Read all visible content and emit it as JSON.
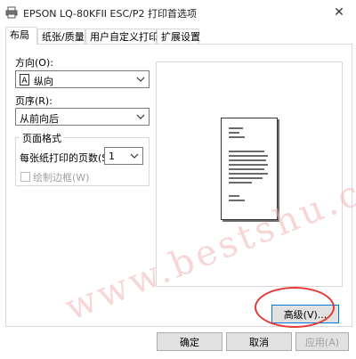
{
  "window": {
    "title": "EPSON LQ-80KFII ESC/P2 打印首选项"
  },
  "tabs": [
    {
      "label": "布局",
      "active": true
    },
    {
      "label": "纸张/质量",
      "active": false
    },
    {
      "label": "用户自定义打印纸",
      "active": false
    },
    {
      "label": "扩展设置",
      "active": false
    }
  ],
  "layout": {
    "orientation_label": "方向(O):",
    "orientation_value": "纵向",
    "page_order_label": "页序(R):",
    "page_order_value": "从前向后",
    "page_format": {
      "group_label": "页面格式",
      "pages_per_sheet_label": "每张纸打印的页数(S)",
      "pages_per_sheet_value": "1",
      "draw_borders_label": "绘制边框(W)",
      "draw_borders_checked": false,
      "draw_borders_enabled": false
    }
  },
  "buttons": {
    "advanced": "高级(V)...",
    "ok": "确定",
    "cancel": "取消",
    "apply": "应用(A)"
  },
  "watermark": "www.bestshu.com",
  "colors": {
    "highlight_ellipse": "#e53935",
    "focus_border": "#0078d7"
  }
}
